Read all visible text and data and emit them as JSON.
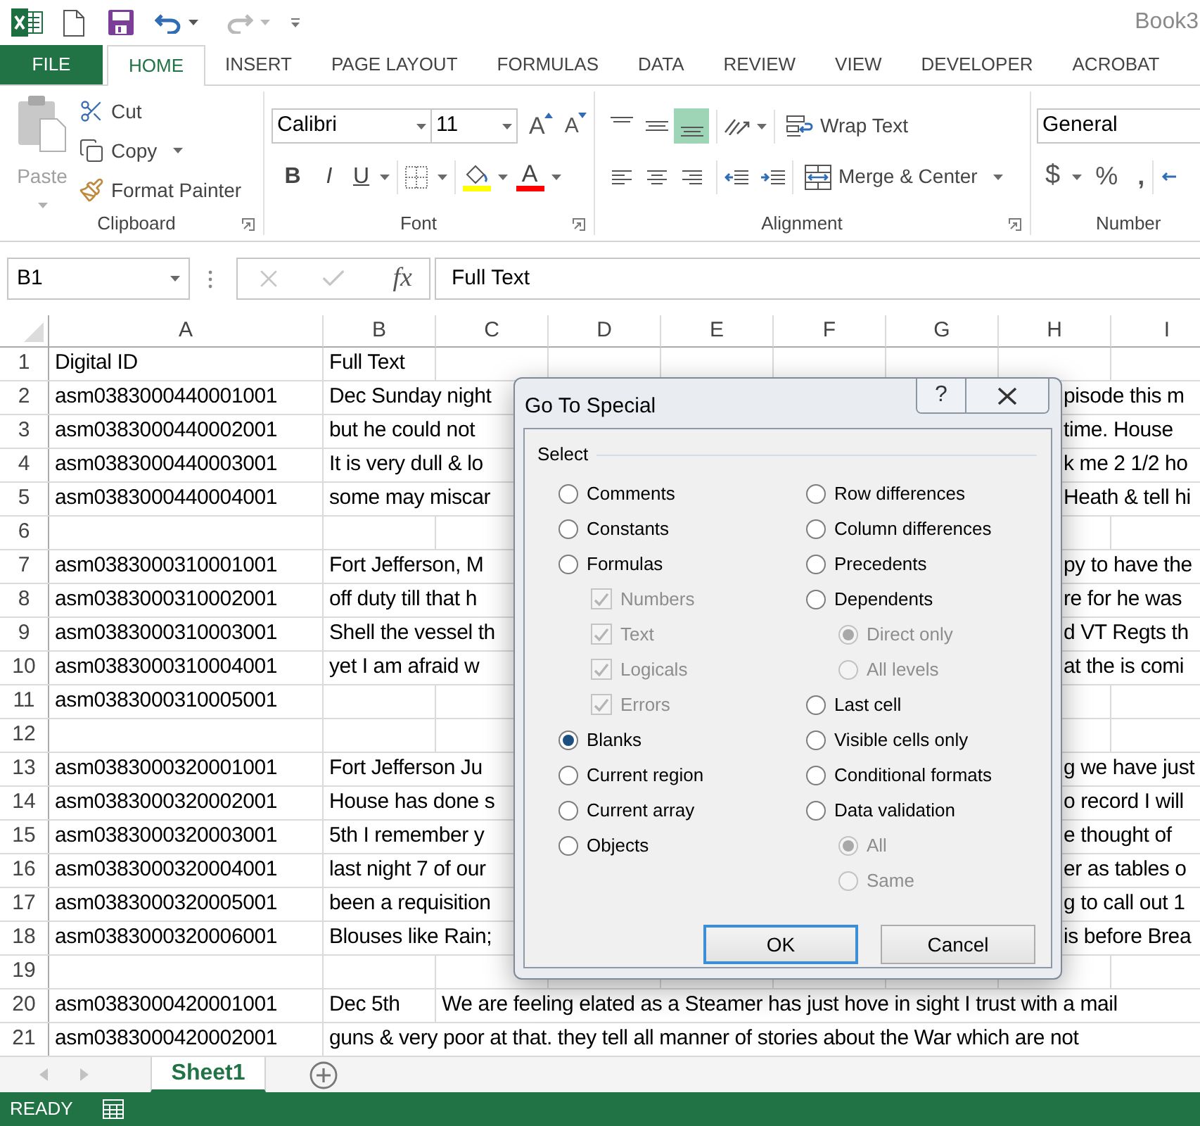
{
  "title_bar": {
    "title": "Book3",
    "redo_disabled": true
  },
  "tabs": [
    {
      "label": "FILE",
      "kind": "backstage",
      "selected": false
    },
    {
      "label": "HOME",
      "kind": "tab",
      "selected": true
    },
    {
      "label": "INSERT",
      "kind": "tab",
      "selected": false
    },
    {
      "label": "PAGE LAYOUT",
      "kind": "tab",
      "selected": false
    },
    {
      "label": "FORMULAS",
      "kind": "tab",
      "selected": false
    },
    {
      "label": "DATA",
      "kind": "tab",
      "selected": false
    },
    {
      "label": "REVIEW",
      "kind": "tab",
      "selected": false
    },
    {
      "label": "VIEW",
      "kind": "tab",
      "selected": false
    },
    {
      "label": "DEVELOPER",
      "kind": "tab",
      "selected": false
    },
    {
      "label": "ACROBAT",
      "kind": "tab",
      "selected": false
    }
  ],
  "ribbon": {
    "clipboard": {
      "label": "Clipboard",
      "paste": {
        "label": "Paste",
        "disabled": true
      },
      "cut": "Cut",
      "copy": "Copy",
      "format_painter": "Format Painter"
    },
    "font": {
      "label": "Font",
      "font_name": "Calibri",
      "font_size": "11",
      "grow": "A",
      "shrink": "A",
      "bold": "B",
      "italic": "I",
      "underline": "U",
      "font_color": "A"
    },
    "alignment": {
      "label": "Alignment",
      "vertical": [
        {
          "kind": "top",
          "selected": false
        },
        {
          "kind": "middle",
          "selected": false
        },
        {
          "kind": "bottom",
          "selected": true
        }
      ],
      "horizontal": [
        {
          "kind": "left",
          "selected": false
        },
        {
          "kind": "center",
          "selected": false
        },
        {
          "kind": "right",
          "selected": false
        }
      ],
      "wrap_text": "Wrap Text",
      "merge": "Merge & Center"
    },
    "number": {
      "label": "Number",
      "format": "General",
      "currency": "$",
      "percent": "%",
      "comma": ","
    }
  },
  "formula_bar": {
    "name_box": "B1",
    "editing": false,
    "function_label": "fx",
    "value": "Full Text"
  },
  "sheet": {
    "columns": [
      "A",
      "B",
      "C",
      "D",
      "E",
      "F",
      "G",
      "H",
      "I"
    ],
    "rows": [
      {
        "number": "1",
        "kind": "plain",
        "a": "Digital ID",
        "b": "Full Text"
      },
      {
        "number": "2",
        "kind": "spill",
        "a": "asm0383000440001001",
        "b": "Dec Sunday night",
        "b_tail": "pisode this m"
      },
      {
        "number": "3",
        "kind": "spill",
        "a": "asm0383000440002001",
        "b": "but he could not",
        "b_tail": "time. House"
      },
      {
        "number": "4",
        "kind": "spill",
        "a": "asm0383000440003001",
        "b": "It is very dull & lo",
        "b_tail": "k me 2 1/2 ho"
      },
      {
        "number": "5",
        "kind": "spill",
        "a": "asm0383000440004001",
        "b": "some may miscar",
        "b_tail": "Heath & tell hi"
      },
      {
        "number": "6",
        "kind": "plain"
      },
      {
        "number": "7",
        "kind": "spill",
        "a": "asm0383000310001001",
        "b": "Fort Jefferson, M",
        "b_tail": "py to have the"
      },
      {
        "number": "8",
        "kind": "spill",
        "a": "asm0383000310002001",
        "b": "off duty till that h",
        "b_tail": "re for he was"
      },
      {
        "number": "9",
        "kind": "spill",
        "a": "asm0383000310003001",
        "b": "Shell the vessel th",
        "b_tail": "d VT Regts th"
      },
      {
        "number": "10",
        "kind": "spill",
        "a": "asm0383000310004001",
        "b": "yet I am afraid w",
        "b_tail": "at the is comi"
      },
      {
        "number": "11",
        "kind": "plain",
        "a": "asm0383000310005001"
      },
      {
        "number": "12",
        "kind": "plain"
      },
      {
        "number": "13",
        "kind": "spill",
        "a": "asm0383000320001001",
        "b": "Fort Jefferson Ju",
        "b_tail": "g we have just"
      },
      {
        "number": "14",
        "kind": "spill",
        "a": "asm0383000320002001",
        "b": "House has done s",
        "b_tail": "o record I will"
      },
      {
        "number": "15",
        "kind": "spill",
        "a": "asm0383000320003001",
        "b": "5th I remember y",
        "b_tail": "e thought of"
      },
      {
        "number": "16",
        "kind": "spill",
        "a": "asm0383000320004001",
        "b": "last night 7 of our",
        "b_tail": "er as tables o"
      },
      {
        "number": "17",
        "kind": "spill",
        "a": "asm0383000320005001",
        "b": "been a requisition",
        "b_tail": "g to call out 1"
      },
      {
        "number": "18",
        "kind": "spill",
        "a": "asm0383000320006001",
        "b": "Blouses like Rain;",
        "b_tail": "is before Brea"
      },
      {
        "number": "19",
        "kind": "plain"
      },
      {
        "number": "20",
        "kind": "spill",
        "a": "asm0383000420001001",
        "b": "Dec 5th",
        "c": "We are feeling elated as a Steamer has just hove in sight I trust with a mail"
      },
      {
        "number": "21",
        "kind": "spill",
        "a": "asm0383000420002001",
        "b": "guns & very poor at that. they tell all manner of stories about the War which are not"
      }
    ]
  },
  "dialog": {
    "title": "Go To Special",
    "help_label": "?",
    "group_label": "Select",
    "left_column": [
      {
        "kind": "radio",
        "label": "Comments",
        "selected": false
      },
      {
        "kind": "radio",
        "label": "Constants",
        "selected": false
      },
      {
        "kind": "radio",
        "label": "Formulas",
        "selected": false,
        "children": [
          {
            "kind": "checkbox",
            "label": "Numbers",
            "checked": true,
            "disabled": true
          },
          {
            "kind": "checkbox",
            "label": "Text",
            "checked": true,
            "disabled": true
          },
          {
            "kind": "checkbox",
            "label": "Logicals",
            "checked": true,
            "disabled": true
          },
          {
            "kind": "checkbox",
            "label": "Errors",
            "checked": true,
            "disabled": true
          }
        ]
      },
      {
        "kind": "radio",
        "label": "Blanks",
        "selected": true
      },
      {
        "kind": "radio",
        "label": "Current region",
        "selected": false
      },
      {
        "kind": "radio",
        "label": "Current array",
        "selected": false
      },
      {
        "kind": "radio",
        "label": "Objects",
        "selected": false
      }
    ],
    "right_column": [
      {
        "kind": "radio",
        "label": "Row differences",
        "selected": false
      },
      {
        "kind": "radio",
        "label": "Column differences",
        "selected": false
      },
      {
        "kind": "radio",
        "label": "Precedents",
        "selected": false
      },
      {
        "kind": "radio",
        "label": "Dependents",
        "selected": false,
        "children": [
          {
            "kind": "radio",
            "label": "Direct only",
            "selected": true,
            "disabled": true
          },
          {
            "kind": "radio",
            "label": "All levels",
            "selected": false,
            "disabled": true
          }
        ]
      },
      {
        "kind": "radio",
        "label": "Last cell",
        "selected": false
      },
      {
        "kind": "radio",
        "label": "Visible cells only",
        "selected": false
      },
      {
        "kind": "radio",
        "label": "Conditional formats",
        "selected": false
      },
      {
        "kind": "radio",
        "label": "Data validation",
        "selected": false,
        "children": [
          {
            "kind": "radio",
            "label": "All",
            "selected": true,
            "disabled": true
          },
          {
            "kind": "radio",
            "label": "Same",
            "selected": false,
            "disabled": true
          }
        ]
      }
    ],
    "buttons": [
      {
        "label": "OK",
        "default": true
      },
      {
        "label": "Cancel",
        "default": false
      }
    ]
  },
  "sheet_tabs": [
    {
      "label": "Sheet1",
      "selected": true
    }
  ],
  "status_bar": {
    "mode": "READY"
  }
}
